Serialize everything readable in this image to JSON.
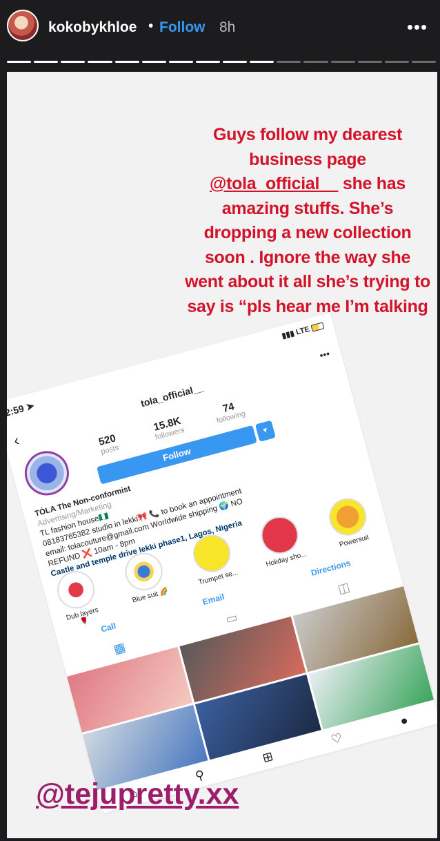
{
  "header": {
    "username": "kokobykhloe",
    "separator": "•",
    "follow_label": "Follow",
    "time_ago": "8h"
  },
  "progress": {
    "total_segments": 16,
    "completed_segments": 10
  },
  "story": {
    "caption_parts": [
      "Guys follow my dearest business page ",
      "@tola_official__",
      "  she has amazing stuffs. She’s dropping a new collection soon . Ignore the way she went about it all she’s trying to say is “pls hear me I’m talking “"
    ],
    "mention": "@tejupretty.xx",
    "screenshot": {
      "clock": "2:59",
      "network": "LTE",
      "handle": "tola_official__",
      "posts": {
        "value": "520",
        "label": "posts"
      },
      "followers": {
        "value": "15.8K",
        "label": "followers"
      },
      "following": {
        "value": "74",
        "label": "following"
      },
      "follow_label": "Follow",
      "bio": {
        "name": "TÒLA  The Non-conformist",
        "category": "Advertising/Marketing",
        "line1": "TL fashion house🇳🇬",
        "line2": "08183765382 studio in lekki🎀 📞 to book an appointment",
        "line3": "email: tolacouture@gmail.com Worldwide shipping 🌍 NO",
        "line4": "REFUND ❌ 10am - 8pm",
        "line5": "Castle and temple drive lekki phase1, Lagos, Nigeria"
      },
      "highlights": [
        "Dub layers 🌹",
        "Blue suit 🌈",
        "Trumpet se...",
        "Holiday sho...",
        "Powersuit"
      ],
      "actions": [
        "Call",
        "Email",
        "Directions"
      ]
    }
  },
  "colors": {
    "caption": "#d3132a",
    "mention": "#9c1e6a",
    "instagram_blue": "#3897f0",
    "story_bg": "#f2f2f2",
    "frame_bg": "#1c1c1e"
  }
}
